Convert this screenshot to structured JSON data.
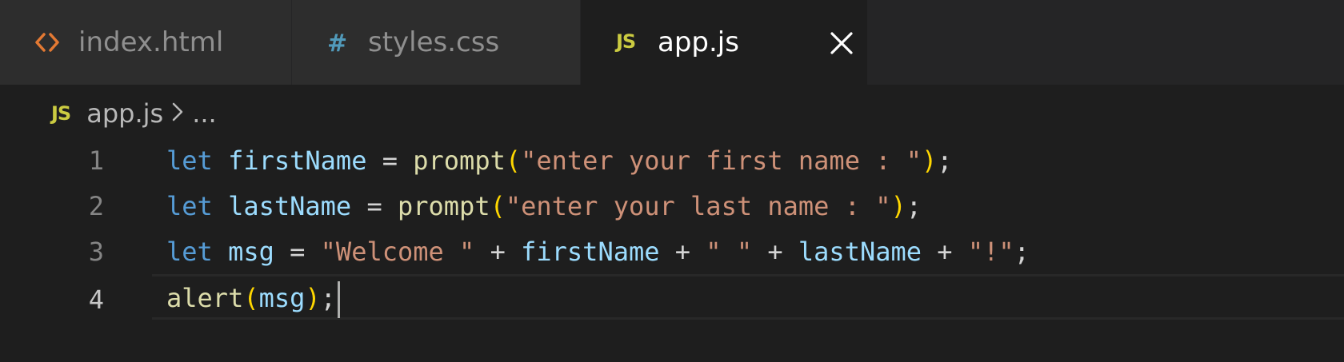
{
  "tabs": [
    {
      "label": "index.html",
      "icon": "html-file-icon",
      "icon_glyph": "<>",
      "icon_color": "#e37933",
      "active": false
    },
    {
      "label": "styles.css",
      "icon": "css-file-icon",
      "icon_glyph": "#",
      "icon_color": "#519aba",
      "active": false
    },
    {
      "label": "app.js",
      "icon": "js-file-icon",
      "icon_glyph": "JS",
      "icon_color": "#cbcb41",
      "active": true
    }
  ],
  "breadcrumb": {
    "icon_glyph": "JS",
    "file": "app.js",
    "separator": ">",
    "rest": "..."
  },
  "editor": {
    "current_line": 4,
    "lines": [
      {
        "number": "1",
        "tokens": [
          "let",
          " ",
          "firstName",
          " = ",
          "prompt",
          "(",
          "\"enter your first name : \"",
          ")",
          ";"
        ]
      },
      {
        "number": "2",
        "tokens": [
          "let",
          " ",
          "lastName",
          " = ",
          "prompt",
          "(",
          "\"enter your last name : \"",
          ")",
          ";"
        ]
      },
      {
        "number": "3",
        "tokens": [
          "let",
          " ",
          "msg",
          " = ",
          "\"Welcome \"",
          " + ",
          "firstName",
          " + ",
          "\" \"",
          " + ",
          "lastName",
          " + ",
          "\"!\"",
          ";"
        ]
      },
      {
        "number": "4",
        "tokens": [
          "alert",
          "(",
          "msg",
          ")",
          ";"
        ]
      }
    ]
  },
  "colors": {
    "keyword": "#569cd6",
    "variable": "#9cdcfe",
    "function": "#dcdcaa",
    "string": "#ce9178",
    "bracket": "#ffd700",
    "background": "#1e1e1e"
  }
}
